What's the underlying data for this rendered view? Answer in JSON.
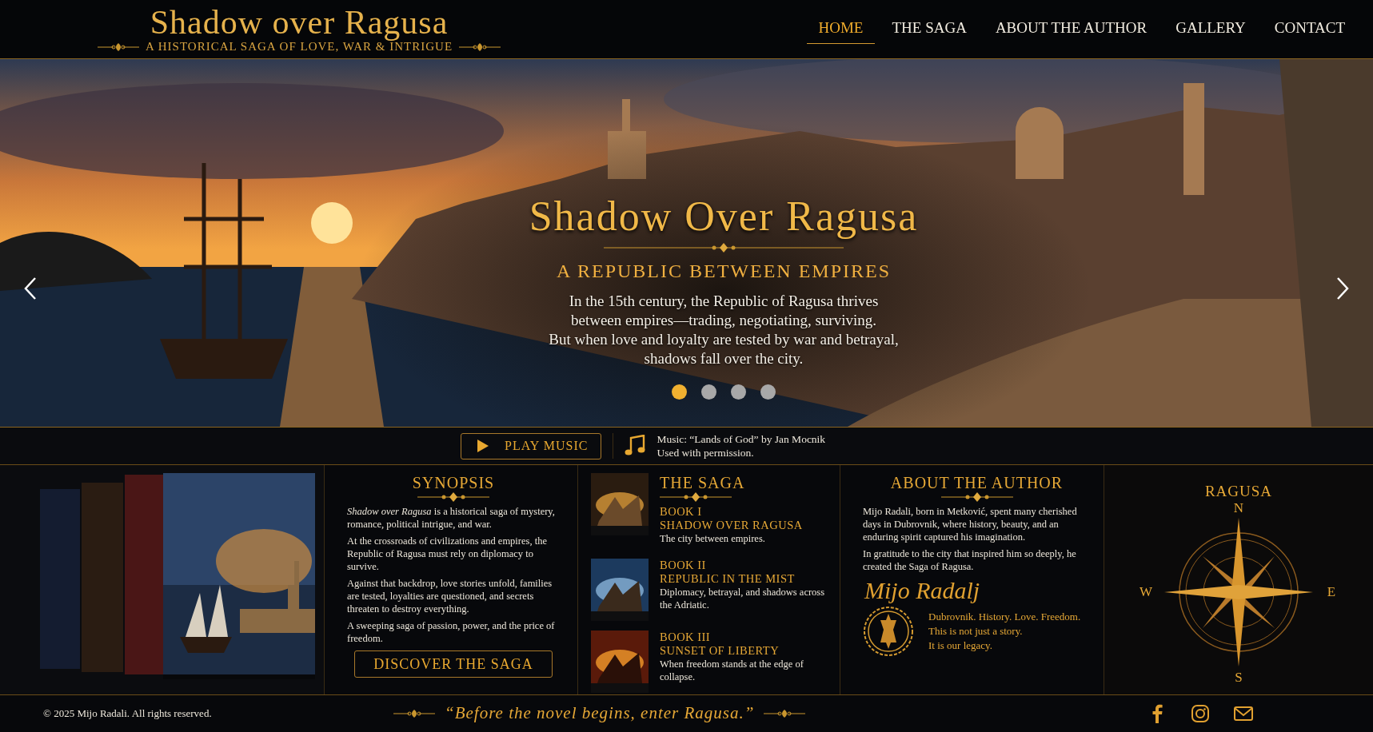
{
  "header": {
    "title": "Shadow over Ragusa",
    "subtitle": "A HISTORICAL SAGA OF LOVE, WAR & INTRIGUE"
  },
  "nav": [
    {
      "label": "HOME",
      "selected": true
    },
    {
      "label": "THE SAGA",
      "selected": false
    },
    {
      "label": "ABOUT THE AUTHOR",
      "selected": false
    },
    {
      "label": "GALLERY",
      "selected": false
    },
    {
      "label": "CONTACT",
      "selected": false
    }
  ],
  "hero": {
    "title": "Shadow Over Ragusa",
    "subtitle": "A REPUBLIC BETWEEN EMPIRES",
    "lines": [
      "In the 15th century, the Republic of Ragusa thrives",
      "between empires—trading, negotiating, surviving.",
      "But when love and loyalty are tested by war and betrayal,",
      "shadows fall over the city."
    ],
    "slides": [
      {
        "selected": true
      },
      {
        "selected": false
      },
      {
        "selected": false
      },
      {
        "selected": false
      }
    ]
  },
  "music": {
    "button": "PLAY MUSIC",
    "credit": [
      "Music: “Lands of God” by Jan Mocnik",
      "Used with permission."
    ]
  },
  "synopsis": {
    "heading": "SYNOPSIS",
    "paragraphs": [
      "*Shadow over Ragusa* is a historical saga of mystery, romance, political intrigue, and war.",
      "At the crossroads of civilizations and empires, the Republic of Ragusa must rely on diplomacy to survive.",
      "Against that backdrop, love stories unfold, families are tested, loyalties are questioned, and secrets threaten to destroy everything.",
      "A sweeping saga of passion, power, and the price of freedom."
    ],
    "button": "DISCOVER THE SAGA"
  },
  "saga": {
    "heading": "THE SAGA",
    "books": [
      {
        "number": "BOOK I",
        "title": "SHADOW OVER RAGUSA",
        "text": "The city between empires."
      },
      {
        "number": "BOOK II",
        "title": "REPUBLIC IN THE MIST",
        "text": "Diplomacy, betrayal, and shadows across the Adriatic."
      },
      {
        "number": "BOOK III",
        "title": "SUNSET OF LIBERTY",
        "text": "When freedom stands at the edge of collapse."
      }
    ]
  },
  "author": {
    "heading": "ABOUT THE AUTHOR",
    "paragraphs": [
      "Mijo Radali, born in Metković, spent many cherished days in Dubrovnik, where history, beauty, and an enduring spirit captured his imagination.",
      "In gratitude to the city that inspired him so deeply, he created the Saga of Ragusa."
    ],
    "signature": "Mijo Radalj",
    "motto": [
      "Dubrovnik. History. Love. Freedom.",
      "This is not just a story.",
      "It is our legacy."
    ]
  },
  "compass": {
    "title": "RAGUSA",
    "north": "N",
    "east": "E",
    "south": "S",
    "west": "W"
  },
  "footer": {
    "copyright": "© 2025 Mijo Radali. All rights reserved.",
    "quote": "“Before the novel begins, enter Ragusa.”"
  }
}
